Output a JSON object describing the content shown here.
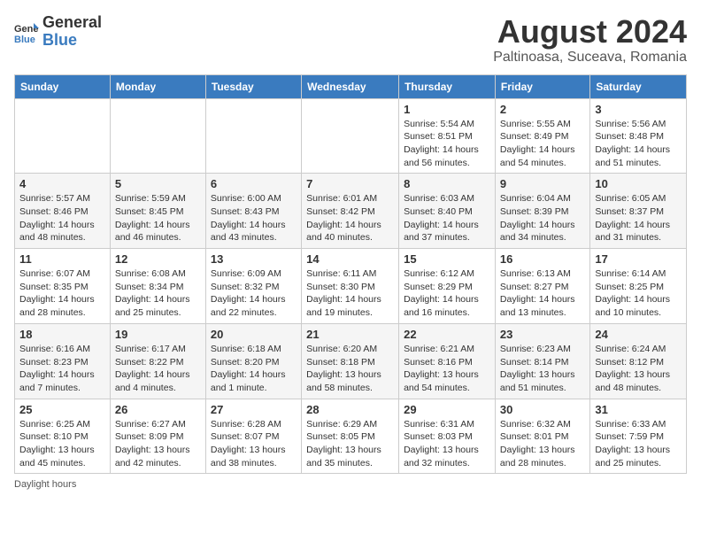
{
  "header": {
    "logo_general": "General",
    "logo_blue": "Blue",
    "month_title": "August 2024",
    "location": "Paltinoasa, Suceava, Romania"
  },
  "weekdays": [
    "Sunday",
    "Monday",
    "Tuesday",
    "Wednesday",
    "Thursday",
    "Friday",
    "Saturday"
  ],
  "footer": {
    "note": "Daylight hours"
  },
  "weeks": [
    [
      {
        "day": "",
        "info": ""
      },
      {
        "day": "",
        "info": ""
      },
      {
        "day": "",
        "info": ""
      },
      {
        "day": "",
        "info": ""
      },
      {
        "day": "1",
        "info": "Sunrise: 5:54 AM\nSunset: 8:51 PM\nDaylight: 14 hours and 56 minutes."
      },
      {
        "day": "2",
        "info": "Sunrise: 5:55 AM\nSunset: 8:49 PM\nDaylight: 14 hours and 54 minutes."
      },
      {
        "day": "3",
        "info": "Sunrise: 5:56 AM\nSunset: 8:48 PM\nDaylight: 14 hours and 51 minutes."
      }
    ],
    [
      {
        "day": "4",
        "info": "Sunrise: 5:57 AM\nSunset: 8:46 PM\nDaylight: 14 hours and 48 minutes."
      },
      {
        "day": "5",
        "info": "Sunrise: 5:59 AM\nSunset: 8:45 PM\nDaylight: 14 hours and 46 minutes."
      },
      {
        "day": "6",
        "info": "Sunrise: 6:00 AM\nSunset: 8:43 PM\nDaylight: 14 hours and 43 minutes."
      },
      {
        "day": "7",
        "info": "Sunrise: 6:01 AM\nSunset: 8:42 PM\nDaylight: 14 hours and 40 minutes."
      },
      {
        "day": "8",
        "info": "Sunrise: 6:03 AM\nSunset: 8:40 PM\nDaylight: 14 hours and 37 minutes."
      },
      {
        "day": "9",
        "info": "Sunrise: 6:04 AM\nSunset: 8:39 PM\nDaylight: 14 hours and 34 minutes."
      },
      {
        "day": "10",
        "info": "Sunrise: 6:05 AM\nSunset: 8:37 PM\nDaylight: 14 hours and 31 minutes."
      }
    ],
    [
      {
        "day": "11",
        "info": "Sunrise: 6:07 AM\nSunset: 8:35 PM\nDaylight: 14 hours and 28 minutes."
      },
      {
        "day": "12",
        "info": "Sunrise: 6:08 AM\nSunset: 8:34 PM\nDaylight: 14 hours and 25 minutes."
      },
      {
        "day": "13",
        "info": "Sunrise: 6:09 AM\nSunset: 8:32 PM\nDaylight: 14 hours and 22 minutes."
      },
      {
        "day": "14",
        "info": "Sunrise: 6:11 AM\nSunset: 8:30 PM\nDaylight: 14 hours and 19 minutes."
      },
      {
        "day": "15",
        "info": "Sunrise: 6:12 AM\nSunset: 8:29 PM\nDaylight: 14 hours and 16 minutes."
      },
      {
        "day": "16",
        "info": "Sunrise: 6:13 AM\nSunset: 8:27 PM\nDaylight: 14 hours and 13 minutes."
      },
      {
        "day": "17",
        "info": "Sunrise: 6:14 AM\nSunset: 8:25 PM\nDaylight: 14 hours and 10 minutes."
      }
    ],
    [
      {
        "day": "18",
        "info": "Sunrise: 6:16 AM\nSunset: 8:23 PM\nDaylight: 14 hours and 7 minutes."
      },
      {
        "day": "19",
        "info": "Sunrise: 6:17 AM\nSunset: 8:22 PM\nDaylight: 14 hours and 4 minutes."
      },
      {
        "day": "20",
        "info": "Sunrise: 6:18 AM\nSunset: 8:20 PM\nDaylight: 14 hours and 1 minute."
      },
      {
        "day": "21",
        "info": "Sunrise: 6:20 AM\nSunset: 8:18 PM\nDaylight: 13 hours and 58 minutes."
      },
      {
        "day": "22",
        "info": "Sunrise: 6:21 AM\nSunset: 8:16 PM\nDaylight: 13 hours and 54 minutes."
      },
      {
        "day": "23",
        "info": "Sunrise: 6:23 AM\nSunset: 8:14 PM\nDaylight: 13 hours and 51 minutes."
      },
      {
        "day": "24",
        "info": "Sunrise: 6:24 AM\nSunset: 8:12 PM\nDaylight: 13 hours and 48 minutes."
      }
    ],
    [
      {
        "day": "25",
        "info": "Sunrise: 6:25 AM\nSunset: 8:10 PM\nDaylight: 13 hours and 45 minutes."
      },
      {
        "day": "26",
        "info": "Sunrise: 6:27 AM\nSunset: 8:09 PM\nDaylight: 13 hours and 42 minutes."
      },
      {
        "day": "27",
        "info": "Sunrise: 6:28 AM\nSunset: 8:07 PM\nDaylight: 13 hours and 38 minutes."
      },
      {
        "day": "28",
        "info": "Sunrise: 6:29 AM\nSunset: 8:05 PM\nDaylight: 13 hours and 35 minutes."
      },
      {
        "day": "29",
        "info": "Sunrise: 6:31 AM\nSunset: 8:03 PM\nDaylight: 13 hours and 32 minutes."
      },
      {
        "day": "30",
        "info": "Sunrise: 6:32 AM\nSunset: 8:01 PM\nDaylight: 13 hours and 28 minutes."
      },
      {
        "day": "31",
        "info": "Sunrise: 6:33 AM\nSunset: 7:59 PM\nDaylight: 13 hours and 25 minutes."
      }
    ]
  ]
}
